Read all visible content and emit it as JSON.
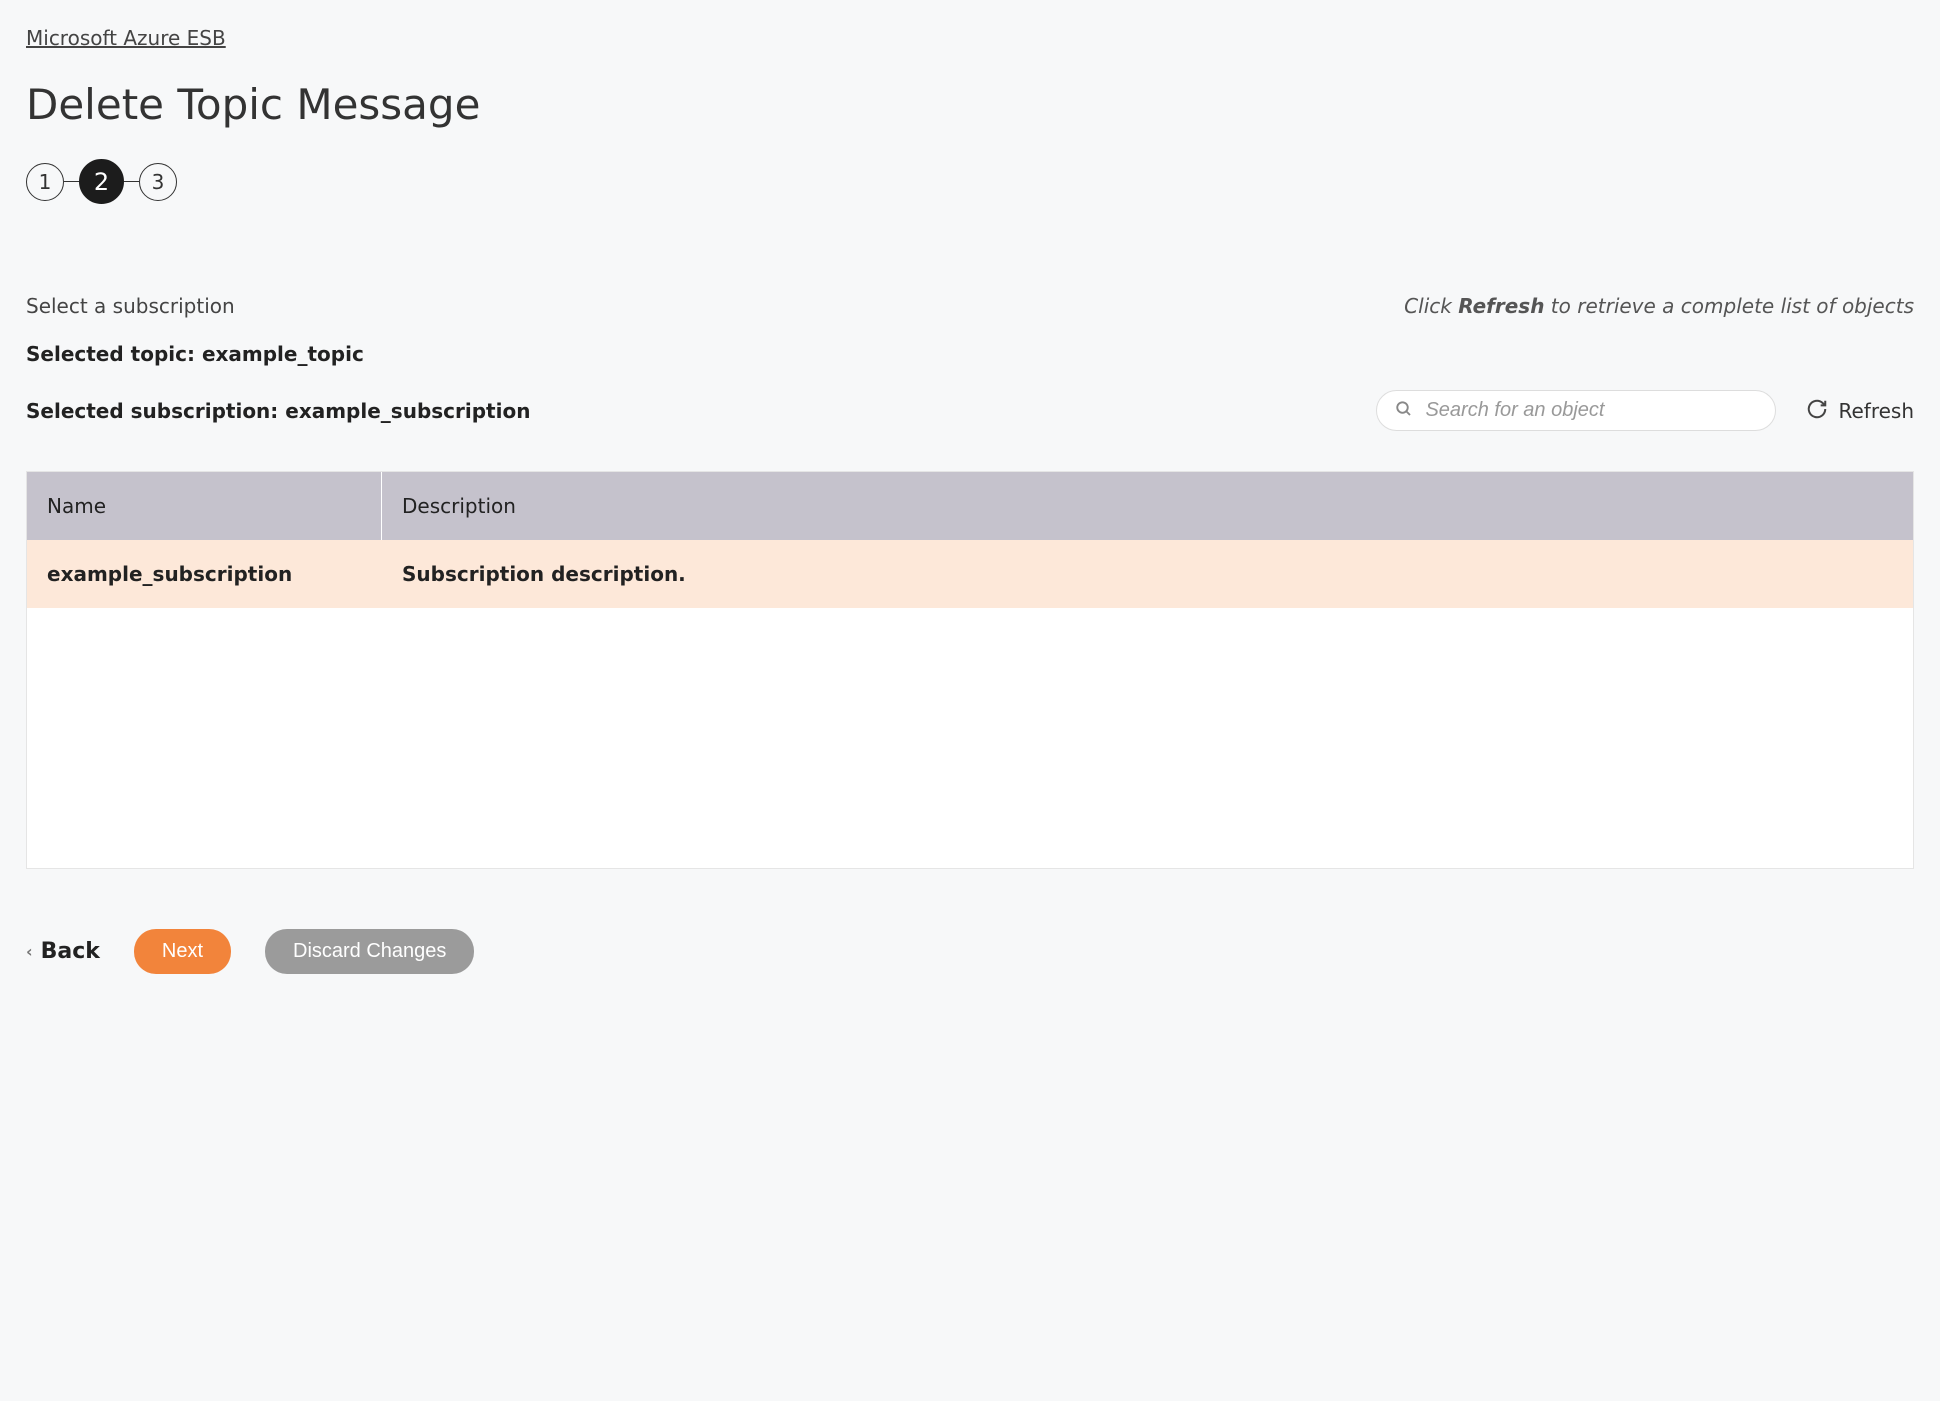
{
  "breadcrumb": "Microsoft Azure ESB",
  "pageTitle": "Delete Topic Message",
  "stepper": {
    "steps": [
      "1",
      "2",
      "3"
    ],
    "activeIndex": 1
  },
  "subtitle": "Select a subscription",
  "helpText": {
    "prefix": "Click ",
    "emphasis": "Refresh",
    "suffix": " to retrieve a complete list of objects"
  },
  "selectedTopic": "Selected topic: example_topic",
  "selectedSubscription": "Selected subscription: example_subscription",
  "search": {
    "placeholder": "Search for an object"
  },
  "refreshLabel": "Refresh",
  "table": {
    "headers": {
      "name": "Name",
      "description": "Description"
    },
    "rows": [
      {
        "name": "example_subscription",
        "description": "Subscription description."
      }
    ]
  },
  "buttons": {
    "back": "Back",
    "next": "Next",
    "discard": "Discard Changes"
  }
}
